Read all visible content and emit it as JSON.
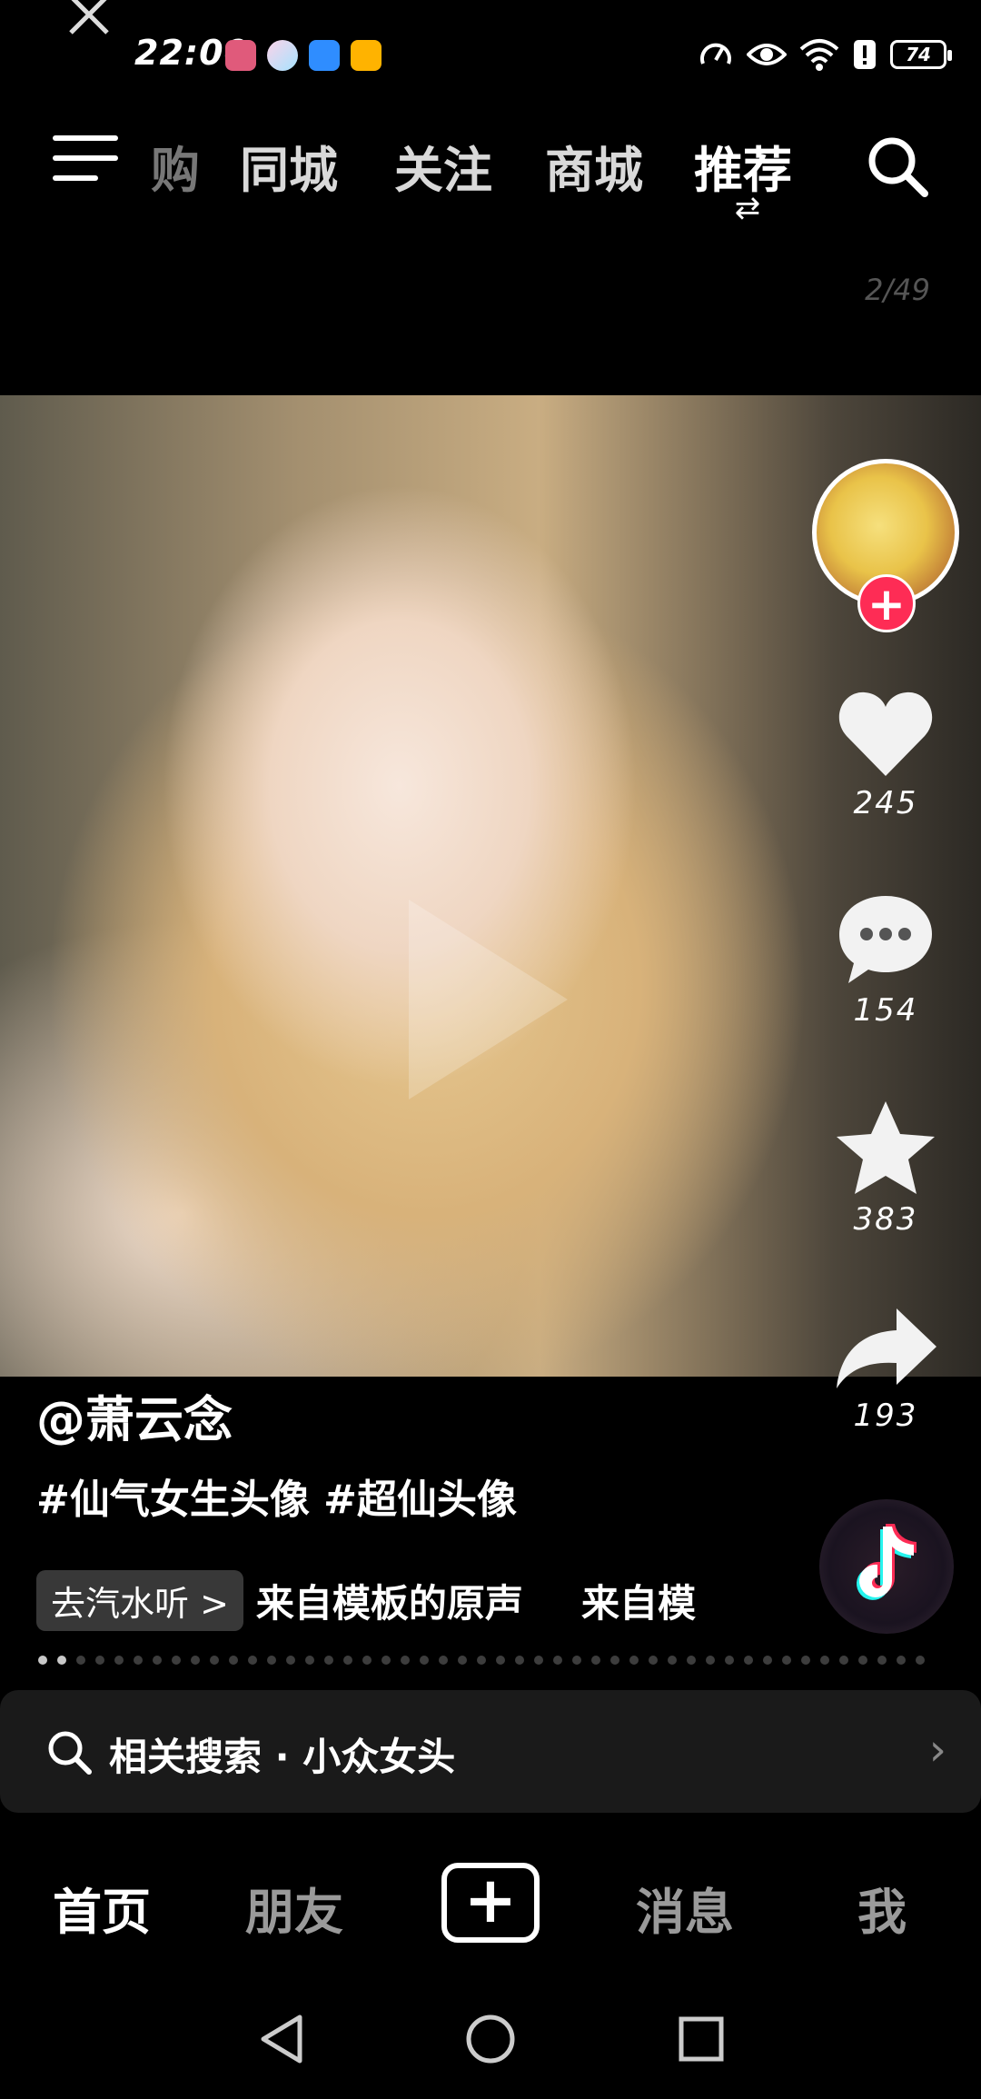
{
  "status_bar": {
    "time": "22:00",
    "battery": "74"
  },
  "top_nav": {
    "tabs": [
      "购",
      "同城",
      "关注",
      "商城",
      "推荐"
    ],
    "active_tab": "推荐"
  },
  "video": {
    "counter": "2/49"
  },
  "rail": {
    "likes": "245",
    "comments": "154",
    "favorites": "383",
    "shares": "193"
  },
  "caption": {
    "author": "@萧云念",
    "description": "#仙气女生头像 #超仙头像",
    "music_button": "去汽水听 >",
    "music_title": "来自模板的原声",
    "music_title_repeat": "来自模"
  },
  "related_search": {
    "label": "相关搜索 · 小众女头"
  },
  "bottom_nav": {
    "home": "首页",
    "friends": "朋友",
    "messages": "消息",
    "me": "我"
  },
  "colors": {
    "accent": "#fe2c55",
    "background": "#000000"
  },
  "icons": [
    "close-icon",
    "menu-icon",
    "search-icon",
    "swap-icon",
    "heart-icon",
    "comment-icon",
    "star-icon",
    "share-icon",
    "tiktok-icon",
    "back-icon",
    "home-icon",
    "recents-icon"
  ]
}
